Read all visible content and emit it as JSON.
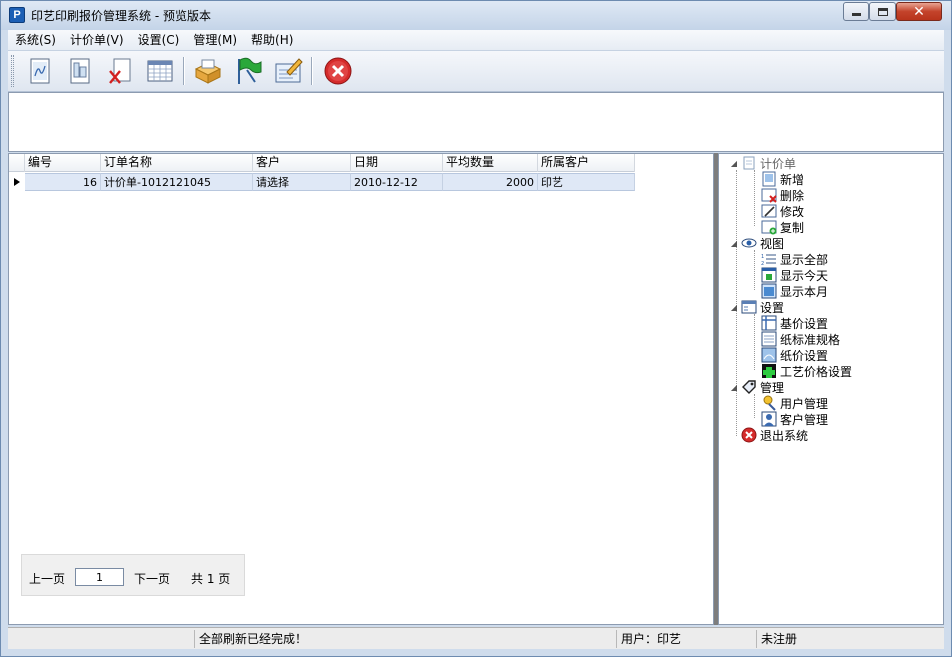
{
  "window": {
    "title": "印艺印刷报价管理系统 - 预览版本",
    "app_icon_letter": "P"
  },
  "menu": [
    {
      "label": "系统(S)"
    },
    {
      "label": "计价单(V)"
    },
    {
      "label": "设置(C)"
    },
    {
      "label": "管理(M)"
    },
    {
      "label": "帮助(H)"
    }
  ],
  "toolbar": [
    {
      "icon": "new-document-icon"
    },
    {
      "icon": "edit-document-icon"
    },
    {
      "icon": "delete-document-icon"
    },
    {
      "icon": "calendar-table-icon"
    },
    {
      "icon": "card-index-icon"
    },
    {
      "icon": "green-flag-icon"
    },
    {
      "icon": "pen-form-icon"
    },
    {
      "icon": "exit-red-icon"
    }
  ],
  "grid": {
    "columns": [
      "编号",
      "订单名称",
      "客户",
      "日期",
      "平均数量",
      "所属客户"
    ],
    "rows": [
      [
        "16",
        "计价单-1012121045",
        "请选择",
        "2010-12-12",
        "2000",
        "印艺"
      ]
    ]
  },
  "pager": {
    "prev_label": "上一页",
    "page_value": "1",
    "next_label": "下一页",
    "total_label": "共 1 页"
  },
  "tree": {
    "groups": [
      {
        "label": "计价单",
        "icon": "document-icon",
        "children": [
          {
            "label": "新增",
            "icon": "new-icon"
          },
          {
            "label": "删除",
            "icon": "delete-icon"
          },
          {
            "label": "修改",
            "icon": "edit-icon"
          },
          {
            "label": "复制",
            "icon": "copy-icon"
          }
        ]
      },
      {
        "label": "视图",
        "icon": "eye-icon",
        "children": [
          {
            "label": "显示全部",
            "icon": "list-icon"
          },
          {
            "label": "显示今天",
            "icon": "calendar-day-icon"
          },
          {
            "label": "显示本月",
            "icon": "calendar-month-icon"
          }
        ]
      },
      {
        "label": "设置",
        "icon": "settings-window-icon",
        "children": [
          {
            "label": "基价设置",
            "icon": "grid-icon"
          },
          {
            "label": "纸标准规格",
            "icon": "paper-size-icon"
          },
          {
            "label": "纸价设置",
            "icon": "paper-price-icon"
          },
          {
            "label": "工艺价格设置",
            "icon": "puzzle-icon"
          }
        ]
      },
      {
        "label": "管理",
        "icon": "tag-icon",
        "children": [
          {
            "label": "用户管理",
            "icon": "user-key-icon"
          },
          {
            "label": "客户管理",
            "icon": "customer-icon"
          }
        ]
      },
      {
        "label": "退出系统",
        "icon": "exit-icon",
        "children": []
      }
    ]
  },
  "status": {
    "message": "全部刷新已经完成！",
    "user": "用户：印艺",
    "registration": "未注册"
  }
}
